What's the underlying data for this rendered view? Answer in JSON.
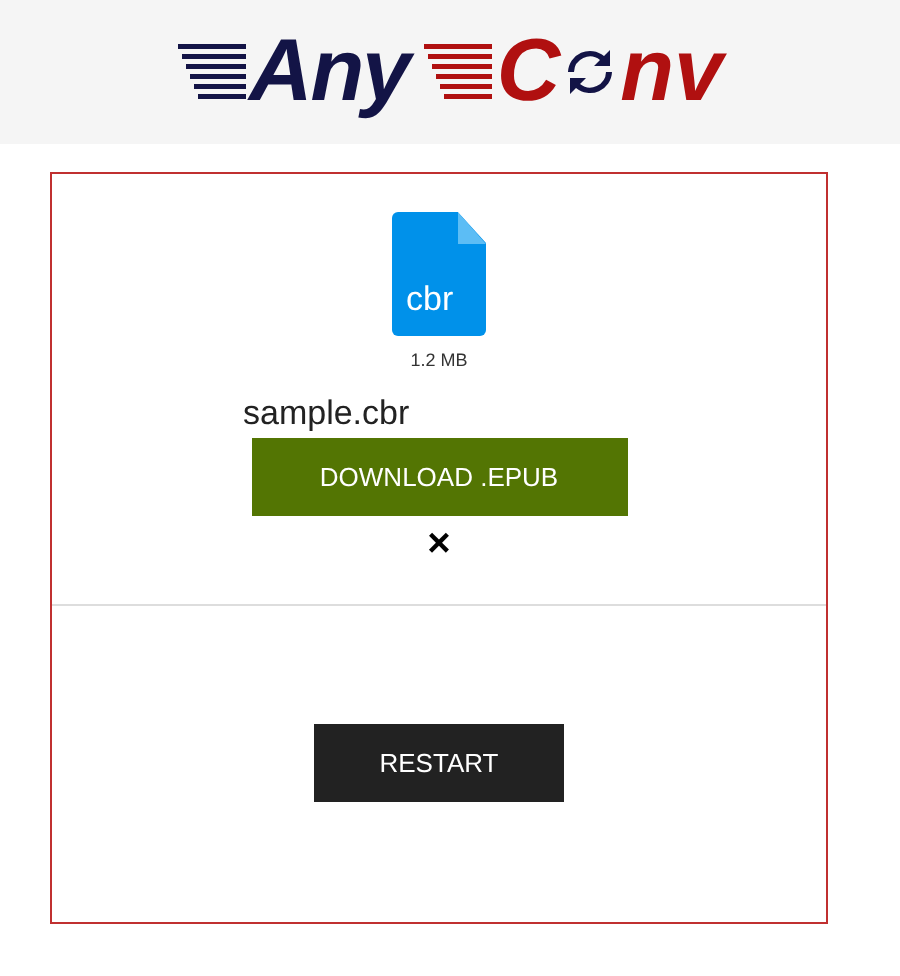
{
  "logo": {
    "first": "Any",
    "second_a": "C",
    "second_b": "nv"
  },
  "file": {
    "extension": "cbr",
    "size": "1.2 MB",
    "name": "sample.cbr"
  },
  "download_button": "DOWNLOAD .EPUB",
  "remove_button": "×",
  "restart_button": "RESTART"
}
